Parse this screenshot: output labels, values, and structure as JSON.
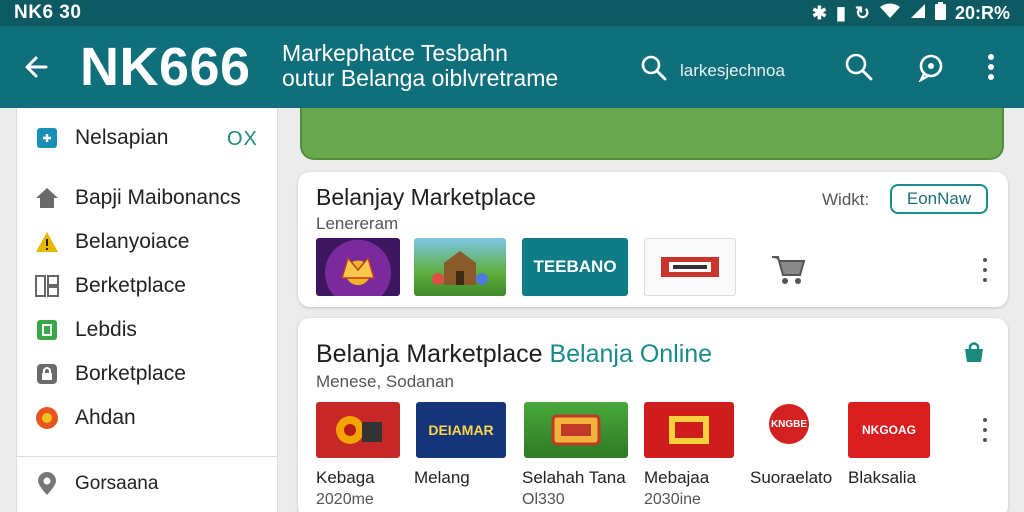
{
  "status_bar": {
    "left_text": "NK6 30",
    "right_text": "20:R%"
  },
  "app_bar": {
    "brand": "NK666",
    "tagline_line1": "Markephatce Tesbahn",
    "tagline_line2": "outur Belanga oiblvretrame",
    "search_placeholder": "larkesjechnoa"
  },
  "sidebar": {
    "close_label": "OX",
    "items": [
      {
        "label": "Nelsapian",
        "icon": "tag-icon"
      },
      {
        "label": "Bapji Maibonancs",
        "icon": "home-icon"
      },
      {
        "label": "Belanyoiace",
        "icon": "warning-icon"
      },
      {
        "label": "Berketplace",
        "icon": "grid-icon"
      },
      {
        "label": "Lebdis",
        "icon": "badge-icon"
      },
      {
        "label": "Borketplace",
        "icon": "lock-icon"
      },
      {
        "label": "Ahdan",
        "icon": "globe-icon"
      },
      {
        "label": "Gorsaana",
        "icon": "location-icon"
      }
    ]
  },
  "card1": {
    "title": "Belanjay Marketplace",
    "subtitle": "Lenereram",
    "side_label": "Widkt:",
    "button": "EonNaw",
    "thumbs": [
      "",
      "",
      "TEEBANO",
      "",
      ""
    ]
  },
  "card2": {
    "title_a": "Belanja  Marketplace",
    "title_b": "Belanja Online",
    "subtitle": "Menese, Sodanan",
    "items": [
      {
        "name": "Kebaga",
        "sub": "2020me",
        "thumb": ""
      },
      {
        "name": "Melang",
        "sub": "",
        "thumb": "DEIAMAR"
      },
      {
        "name": "Selahah Tana",
        "sub": "Ol330",
        "thumb": ""
      },
      {
        "name": "Mebajaa",
        "sub": "2030ine",
        "thumb": ""
      },
      {
        "name": "Suoraelato",
        "sub": "",
        "thumb": "KNGBE"
      },
      {
        "name": "Blaksalia",
        "sub": "",
        "thumb": "NKGOAG"
      }
    ]
  },
  "colors": {
    "appbar": "#0f6f7a",
    "status": "#0e5a63",
    "accent": "#1a8a8a",
    "banner": "#6aa84f"
  }
}
